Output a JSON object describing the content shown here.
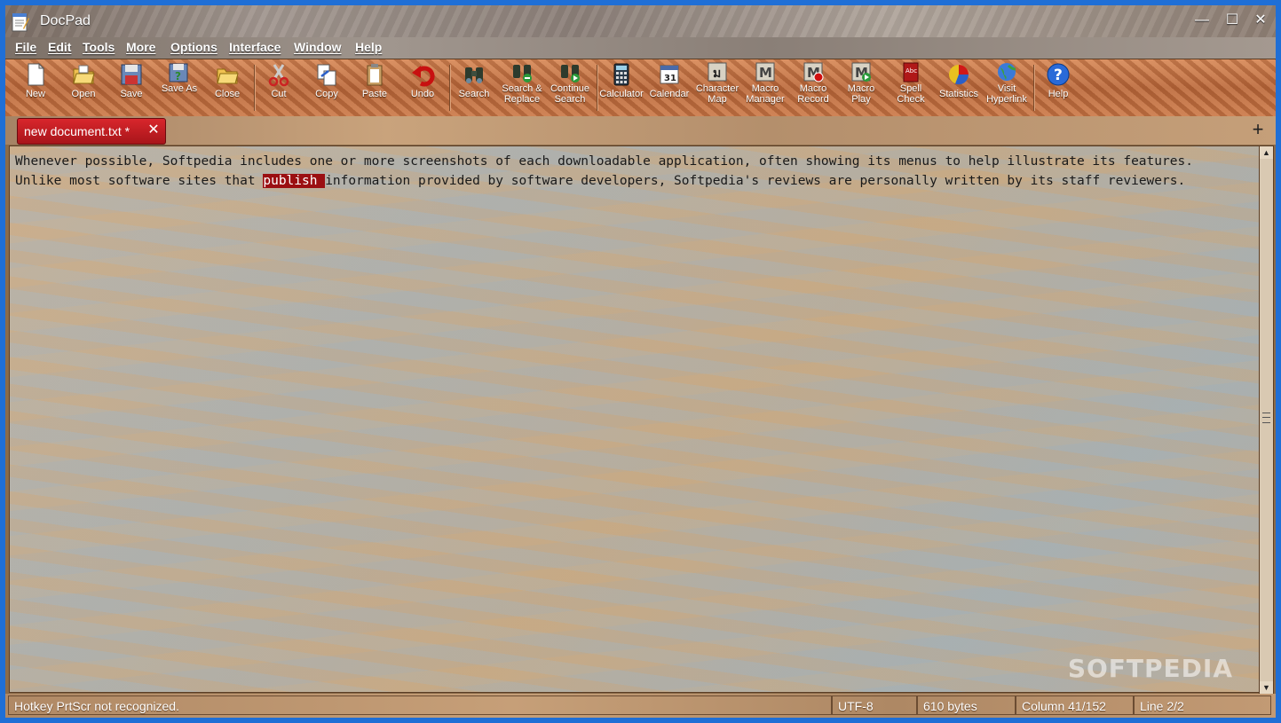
{
  "window": {
    "title": "DocPad",
    "controls": {
      "minimize": "—",
      "maximize": "☐",
      "close": "✕"
    }
  },
  "menu": [
    "File",
    "Edit",
    "Tools",
    "More",
    "Options",
    "Interface",
    "Window",
    "Help"
  ],
  "toolbar": [
    {
      "id": "new",
      "label": "New",
      "icon": "new-document-icon"
    },
    {
      "id": "open",
      "label": "Open",
      "icon": "open-folder-icon"
    },
    {
      "id": "save",
      "label": "Save",
      "icon": "floppy-disk-icon"
    },
    {
      "id": "save-as",
      "label": "Save As",
      "icon": "save-as-icon"
    },
    {
      "id": "close",
      "label": "Close",
      "icon": "close-folder-icon"
    },
    {
      "id": "cut",
      "label": "Cut",
      "icon": "scissors-icon"
    },
    {
      "id": "copy",
      "label": "Copy",
      "icon": "copy-icon"
    },
    {
      "id": "paste",
      "label": "Paste",
      "icon": "clipboard-icon"
    },
    {
      "id": "undo",
      "label": "Undo",
      "icon": "undo-arrow-icon"
    },
    {
      "id": "search",
      "label": "Search",
      "icon": "binoculars-icon"
    },
    {
      "id": "search-replace",
      "label": "Search & Replace",
      "icon": "binoculars-replace-icon"
    },
    {
      "id": "continue-search",
      "label": "Continue Search",
      "icon": "binoculars-continue-icon"
    },
    {
      "id": "calculator",
      "label": "Calculator",
      "icon": "calculator-icon"
    },
    {
      "id": "calendar",
      "label": "Calendar",
      "icon": "calendar-icon"
    },
    {
      "id": "character-map",
      "label": "Character Map",
      "icon": "character-map-icon"
    },
    {
      "id": "macro-manager",
      "label": "Macro Manager",
      "icon": "macro-icon"
    },
    {
      "id": "macro-record",
      "label": "Macro Record",
      "icon": "macro-record-icon"
    },
    {
      "id": "macro-play",
      "label": "Macro Play",
      "icon": "macro-play-icon"
    },
    {
      "id": "spell-check",
      "label": "Spell Check",
      "icon": "spell-check-book-icon"
    },
    {
      "id": "statistics",
      "label": "Statistics",
      "icon": "pie-chart-icon"
    },
    {
      "id": "visit-hyperlink",
      "label": "Visit Hyperlink",
      "icon": "globe-link-icon"
    },
    {
      "id": "help",
      "label": "Help",
      "icon": "help-question-icon"
    }
  ],
  "tabs": [
    {
      "label": "new document.txt *",
      "close": "✕"
    }
  ],
  "tab_add": "+",
  "editor": {
    "line1": "Whenever possible, Softpedia includes one or more screenshots of each downloadable application, often showing its menus to help illustrate its features.",
    "line2_before": "Unlike most software sites that ",
    "line2_selected": "publish ",
    "line2_after": "information provided by software developers, Softpedia's reviews are personally written by its staff reviewers.",
    "watermark": "SOFTPEDIA"
  },
  "scrollbar": {
    "up": "▲",
    "down": "▼"
  },
  "status": {
    "message": "Hotkey PrtScr not recognized.",
    "encoding": "UTF-8",
    "size": "610 bytes",
    "column": "Column 41/152",
    "line": "Line 2/2"
  },
  "colors": {
    "selection": "#9b0f12",
    "tab": "#c81e24",
    "toolbar": "#c77a4e"
  }
}
